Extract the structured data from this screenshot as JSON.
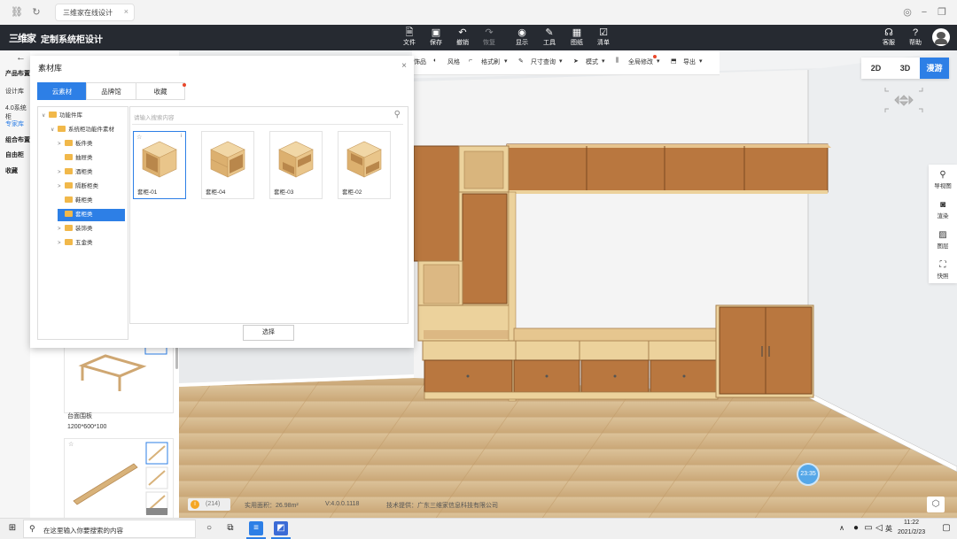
{
  "browser": {
    "tab_title": "三维家在线设计",
    "close_glyph": "×"
  },
  "app": {
    "logo_mark": "三维家",
    "title": "定制系统柜设计",
    "tools": [
      "文件",
      "保存",
      "撤销",
      "恢复",
      "显示",
      "工具",
      "图纸",
      "清单"
    ],
    "right_tools": [
      "客服",
      "帮助"
    ]
  },
  "left_nav": {
    "items": [
      "产品布置",
      "设计库",
      "4.0系统柜",
      "专家库",
      "组合布置",
      "自由柜",
      "收藏"
    ],
    "active_item": "专家库"
  },
  "side_panel": {
    "card1_name": "台面围板",
    "card1_size": "1200*600*100"
  },
  "toolbar2": {
    "items": [
      "饰品",
      "风格",
      "格式刷",
      "尺寸查询",
      "模式",
      "全局修改",
      "导出"
    ]
  },
  "view_modes": [
    "2D",
    "3D",
    "漫游"
  ],
  "active_mode": "漫游",
  "right_rail": [
    "导视图",
    "渲染",
    "图层",
    "快照"
  ],
  "dialog": {
    "title": "素材库",
    "close": "×",
    "tabs": [
      "云素材",
      "品牌馆",
      "收藏"
    ],
    "active_tab": "云素材",
    "search_placeholder": "请输入搜索内容",
    "tree": [
      {
        "label": "功能件库",
        "level": 0,
        "arrow": "∨"
      },
      {
        "label": "系统柜功能件素材",
        "level": 1,
        "arrow": "∨"
      },
      {
        "label": "板件类",
        "level": 2,
        "arrow": ">"
      },
      {
        "label": "抽屉类",
        "level": 2,
        "arrow": ""
      },
      {
        "label": "酒柜类",
        "level": 2,
        "arrow": ">"
      },
      {
        "label": "隔断柜类",
        "level": 2,
        "arrow": ">"
      },
      {
        "label": "鞋柜类",
        "level": 2,
        "arrow": ""
      },
      {
        "label": "套柜类",
        "level": 2,
        "arrow": "",
        "selected": true
      },
      {
        "label": "装饰类",
        "level": 2,
        "arrow": ">"
      },
      {
        "label": "五金类",
        "level": 2,
        "arrow": ">"
      }
    ],
    "materials": [
      "套柜-01",
      "套柜-04",
      "套柜-03",
      "套柜-02"
    ],
    "selected_material": "套柜-01",
    "choose_button": "选择"
  },
  "scene": {
    "timer_label": "23:35"
  },
  "status": {
    "count": "(214)",
    "area": "实用面积：26.98m²",
    "version": "V:4.0.0.1118",
    "provider": "技术提供：广东三维家信息科技有限公司"
  },
  "taskbar": {
    "search_placeholder": "在这里输入你要搜索的内容",
    "ime": "英",
    "time": "11:22",
    "date": "2021/2/23"
  },
  "colors": {
    "accent": "#2d7fe6",
    "header_bg": "#262a31",
    "wood_dark": "#b9773f",
    "wood_light": "#ecd29c"
  }
}
